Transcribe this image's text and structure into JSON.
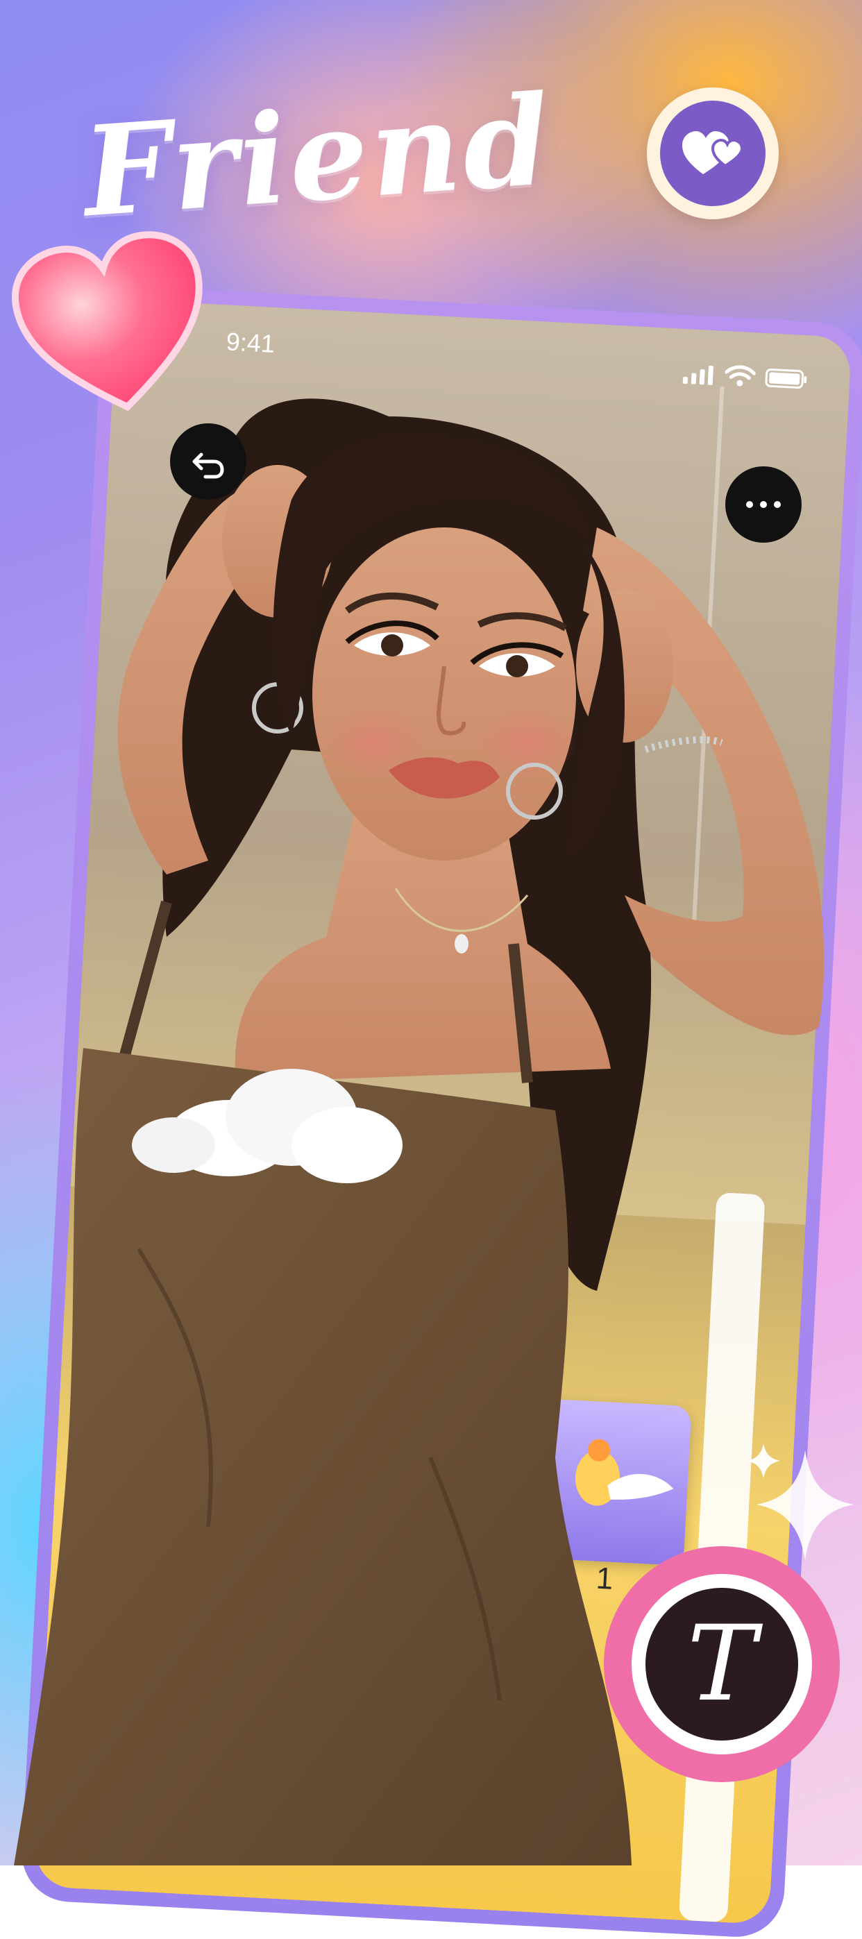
{
  "app": {
    "brand_title": "Friend"
  },
  "phone": {
    "status_time": "9:41"
  },
  "preview": {
    "mini_card_number": "1"
  },
  "badge": {
    "letter": "T"
  },
  "colors": {
    "brand_purple": "#7c5bc6",
    "badge_pink": "#ef6ea8",
    "frame_purple": "#9a82ee"
  },
  "icons": {
    "top_badge": "double-heart-icon",
    "floating": "heart-icon",
    "undo": "undo-icon",
    "more": "more-icon",
    "sparkle": "sparkle-icon"
  }
}
